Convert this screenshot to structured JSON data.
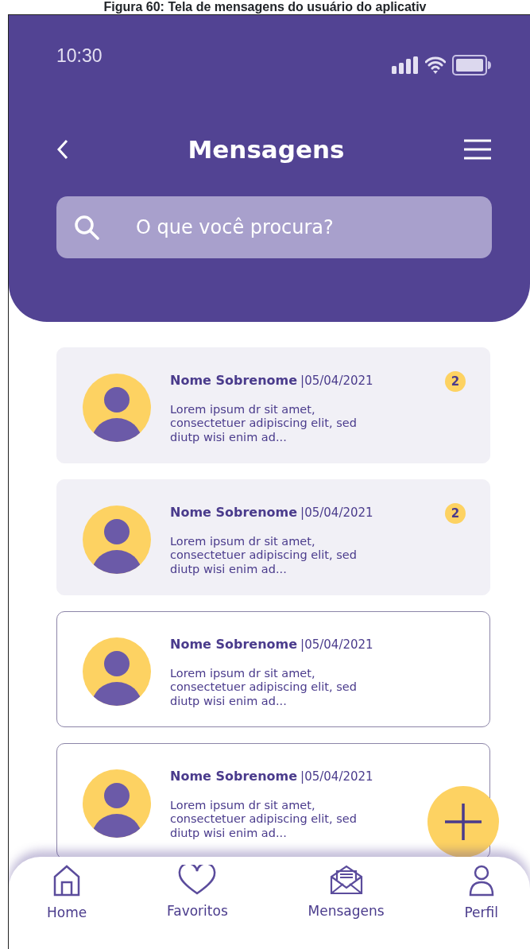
{
  "caption": "Figura 60: Tela de mensagens do usuário do aplicativ",
  "status_bar": {
    "time": "10:30"
  },
  "header": {
    "title": "Mensagens"
  },
  "search": {
    "placeholder": "O que você procura?"
  },
  "messages": [
    {
      "name": "Nome Sobrenome",
      "date": "|05/04/2021",
      "preview": "Lorem ipsum dr sit amet, consectetuer adipiscing elit, sed diutp wisi enim ad...",
      "unread": true,
      "badge": "2"
    },
    {
      "name": "Nome Sobrenome",
      "date": "|05/04/2021",
      "preview": "Lorem ipsum dr sit amet, consectetuer adipiscing elit, sed diutp wisi enim ad...",
      "unread": true,
      "badge": "2"
    },
    {
      "name": "Nome Sobrenome",
      "date": "|05/04/2021",
      "preview": "Lorem ipsum dr sit amet, consectetuer adipiscing elit, sed diutp wisi enim ad...",
      "unread": false
    },
    {
      "name": "Nome Sobrenome",
      "date": "|05/04/2021",
      "preview": "Lorem ipsum dr sit amet, consectetuer adipiscing elit, sed diutp wisi enim ad...",
      "unread": false
    }
  ],
  "bottom_nav": [
    {
      "label": "Home",
      "kind": "home"
    },
    {
      "label": "Favoritos",
      "kind": "heart"
    },
    {
      "label": "Mensagens",
      "kind": "mail"
    },
    {
      "label": "Perfil",
      "kind": "user"
    }
  ]
}
